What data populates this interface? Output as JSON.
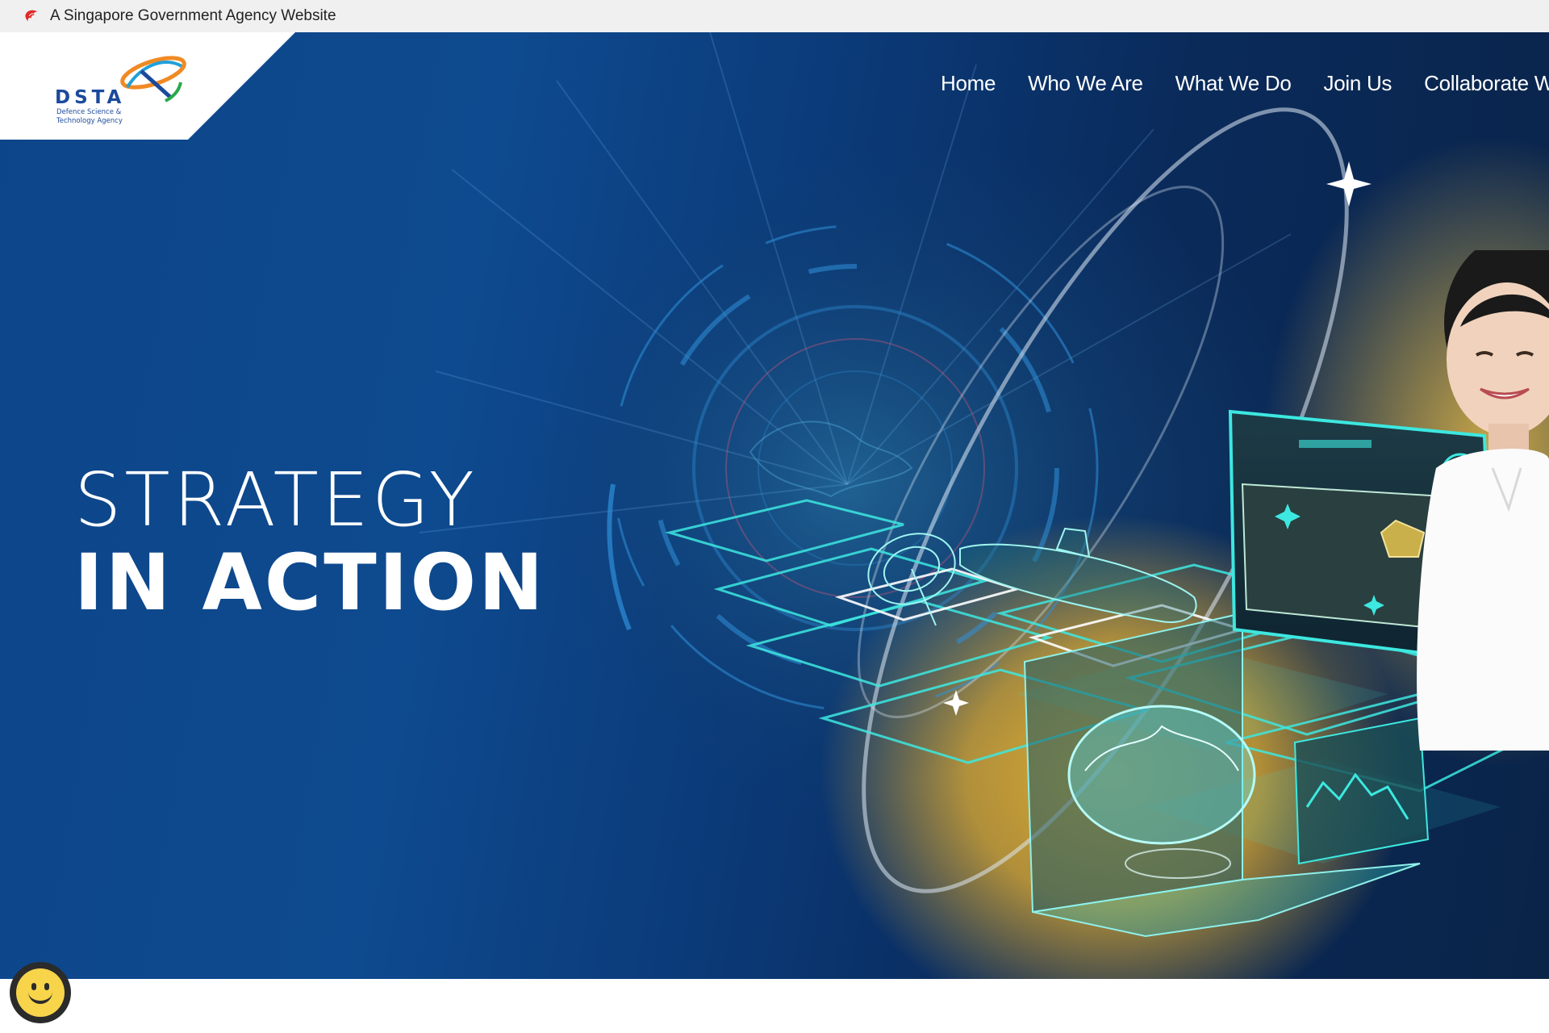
{
  "masthead": {
    "text": "A Singapore Government Agency Website",
    "icon": "singapore-lion-icon"
  },
  "logo": {
    "abbr": "DSTA",
    "line1": "Defence Science &",
    "line2": "Technology Agency"
  },
  "nav": {
    "items": [
      {
        "label": "Home"
      },
      {
        "label": "Who We Are"
      },
      {
        "label": "What We Do"
      },
      {
        "label": "Join Us"
      },
      {
        "label": "Collaborate Wit"
      }
    ]
  },
  "hero": {
    "headline_line1": "STRATEGY",
    "headline_line2": "IN ACTION"
  },
  "feedback": {
    "icon": "smiley-face-icon"
  },
  "colors": {
    "hero_blue": "#0d4589",
    "accent_gold": "#e8b02e",
    "accent_cyan": "#3de8e0",
    "masthead_bg": "#f0f0f0"
  }
}
